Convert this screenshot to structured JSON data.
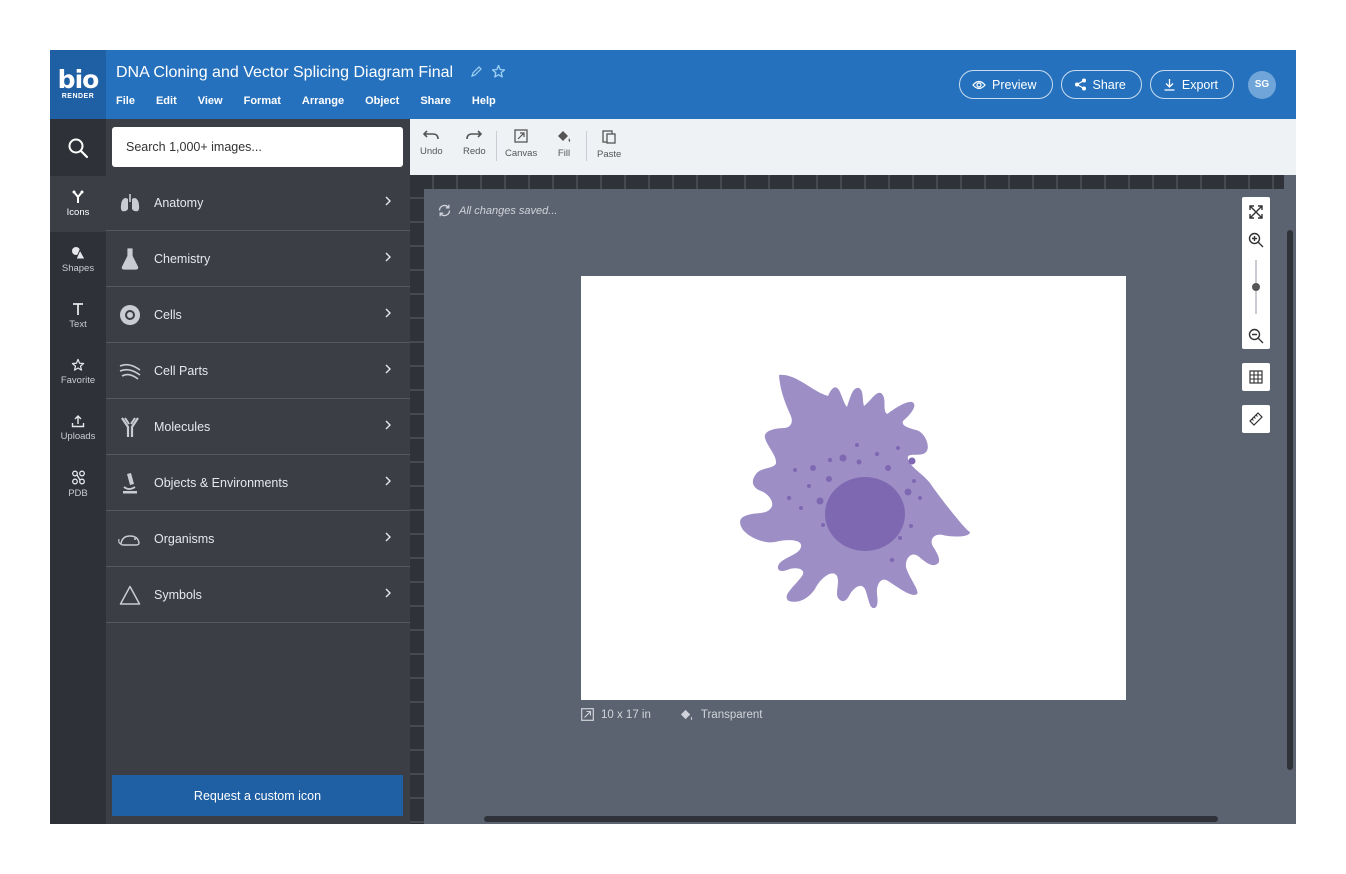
{
  "logo": {
    "mark": "bio",
    "sub": "RENDER"
  },
  "document": {
    "title": "DNA Cloning and Vector Splicing Diagram Final"
  },
  "menu": [
    "File",
    "Edit",
    "View",
    "Format",
    "Arrange",
    "Object",
    "Share",
    "Help"
  ],
  "actions": {
    "preview": "Preview",
    "share": "Share",
    "export": "Export",
    "avatar": "SG"
  },
  "rail": [
    {
      "label": "Icons",
      "icon": "icons-icon"
    },
    {
      "label": "Shapes",
      "icon": "shapes-icon"
    },
    {
      "label": "Text",
      "icon": "text-icon"
    },
    {
      "label": "Favorite",
      "icon": "star-icon"
    },
    {
      "label": "Uploads",
      "icon": "upload-icon"
    },
    {
      "label": "PDB",
      "icon": "pdb-icon"
    }
  ],
  "search": {
    "placeholder": "Search 1,000+ images..."
  },
  "categories": [
    {
      "label": "Anatomy",
      "icon": "lungs-icon"
    },
    {
      "label": "Chemistry",
      "icon": "flask-icon"
    },
    {
      "label": "Cells",
      "icon": "cell-icon"
    },
    {
      "label": "Cell Parts",
      "icon": "cell-parts-icon"
    },
    {
      "label": "Molecules",
      "icon": "antibody-icon"
    },
    {
      "label": "Objects & Environments",
      "icon": "microscope-icon"
    },
    {
      "label": "Organisms",
      "icon": "mouse-icon"
    },
    {
      "label": "Symbols",
      "icon": "triangle-icon"
    }
  ],
  "custom_icon_button": "Request a custom icon",
  "toolbar": {
    "undo": "Undo",
    "redo": "Redo",
    "canvas": "Canvas",
    "fill": "Fill",
    "paste": "Paste"
  },
  "status": {
    "saved": "All changes saved..."
  },
  "canvas_info": {
    "size": "10 x 17 in",
    "background": "Transparent"
  },
  "colors": {
    "header": "#2571bd",
    "cell": "#9d8ec6",
    "nucleus": "#7e68b1"
  }
}
